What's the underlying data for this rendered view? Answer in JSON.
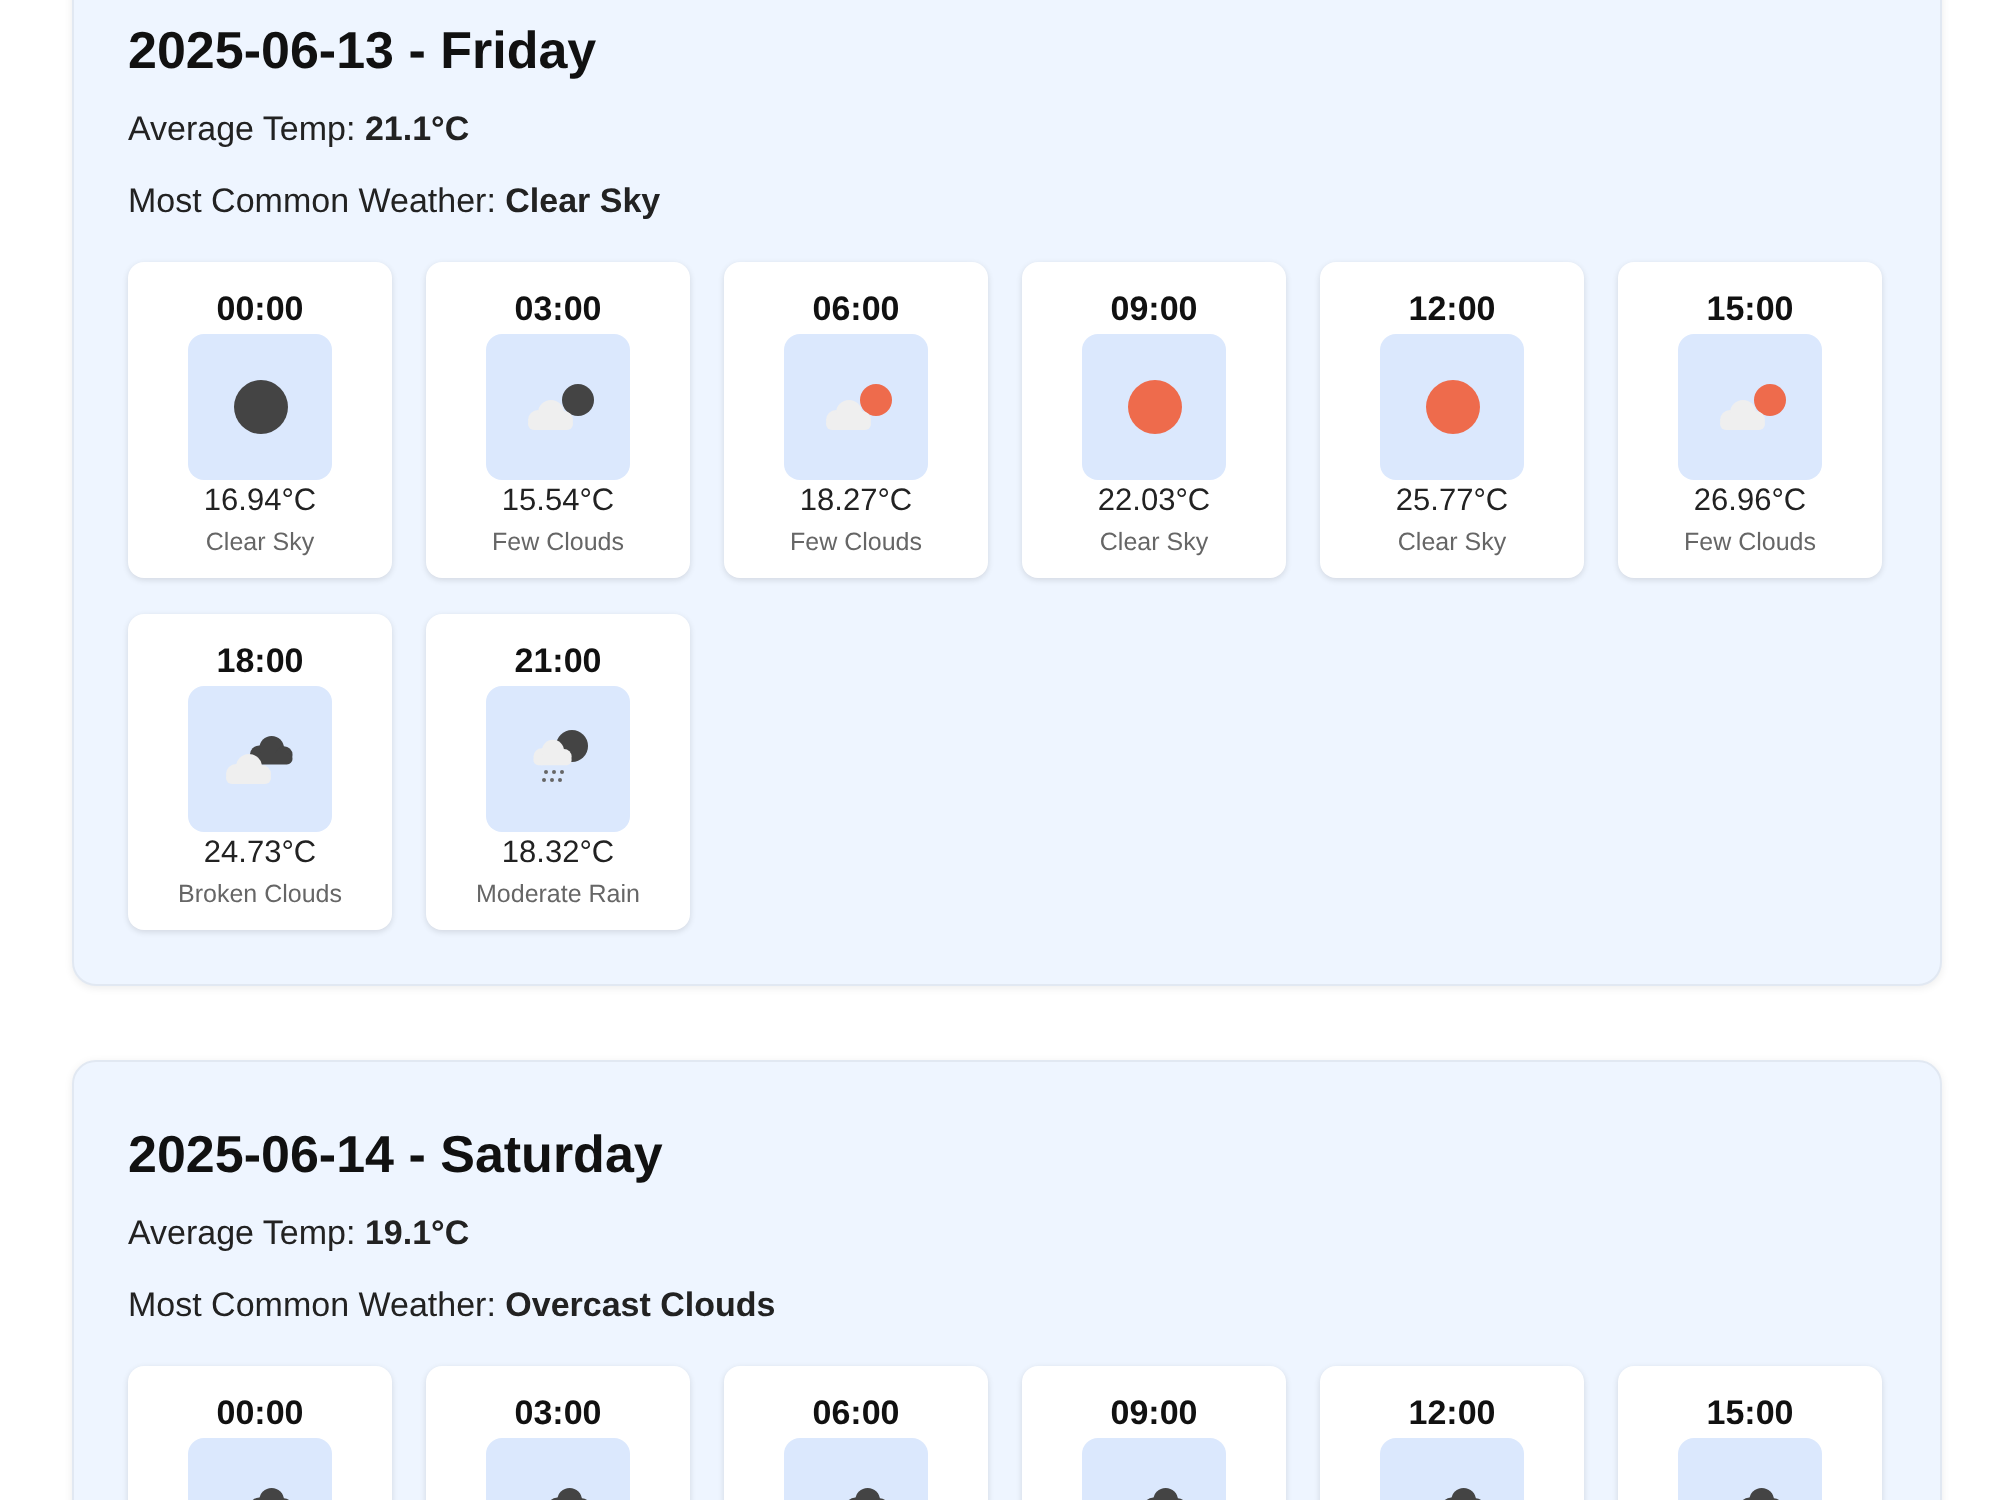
{
  "days": [
    {
      "title": "2025-06-13 - Friday",
      "average_temp": "Average Temp: **21.1°C**",
      "most_common_weather": "Most Common Weather: **Clear Sky**",
      "hours": [
        {
          "time": "00:00",
          "kind": "clear-night",
          "temp": "16.94°C",
          "description": "Clear Sky"
        },
        {
          "time": "03:00",
          "kind": "few-clouds-night",
          "temp": "15.54°C",
          "description": "Few Clouds"
        },
        {
          "time": "06:00",
          "kind": "few-clouds-day",
          "temp": "18.27°C",
          "description": "Few Clouds"
        },
        {
          "time": "09:00",
          "kind": "clear-day",
          "temp": "22.03°C",
          "description": "Clear Sky"
        },
        {
          "time": "12:00",
          "kind": "clear-day",
          "temp": "25.77°C",
          "description": "Clear Sky"
        },
        {
          "time": "15:00",
          "kind": "few-clouds-day",
          "temp": "26.96°C",
          "description": "Few Clouds"
        },
        {
          "time": "18:00",
          "kind": "broken-clouds",
          "temp": "24.73°C",
          "description": "Broken Clouds"
        },
        {
          "time": "21:00",
          "kind": "rain-night",
          "temp": "18.32°C",
          "description": "Moderate Rain"
        }
      ]
    },
    {
      "title": "2025-06-14 - Saturday",
      "average_temp": "Average Temp: **19.1°C**",
      "most_common_weather": "Most Common Weather: **Overcast Clouds**",
      "hours": [
        {
          "time": "00:00",
          "kind": "overcast"
        },
        {
          "time": "03:00",
          "kind": "overcast"
        },
        {
          "time": "06:00",
          "kind": "overcast"
        },
        {
          "time": "09:00",
          "kind": "overcast"
        },
        {
          "time": "12:00",
          "kind": "overcast"
        },
        {
          "time": "15:00",
          "kind": "overcast"
        }
      ]
    }
  ]
}
